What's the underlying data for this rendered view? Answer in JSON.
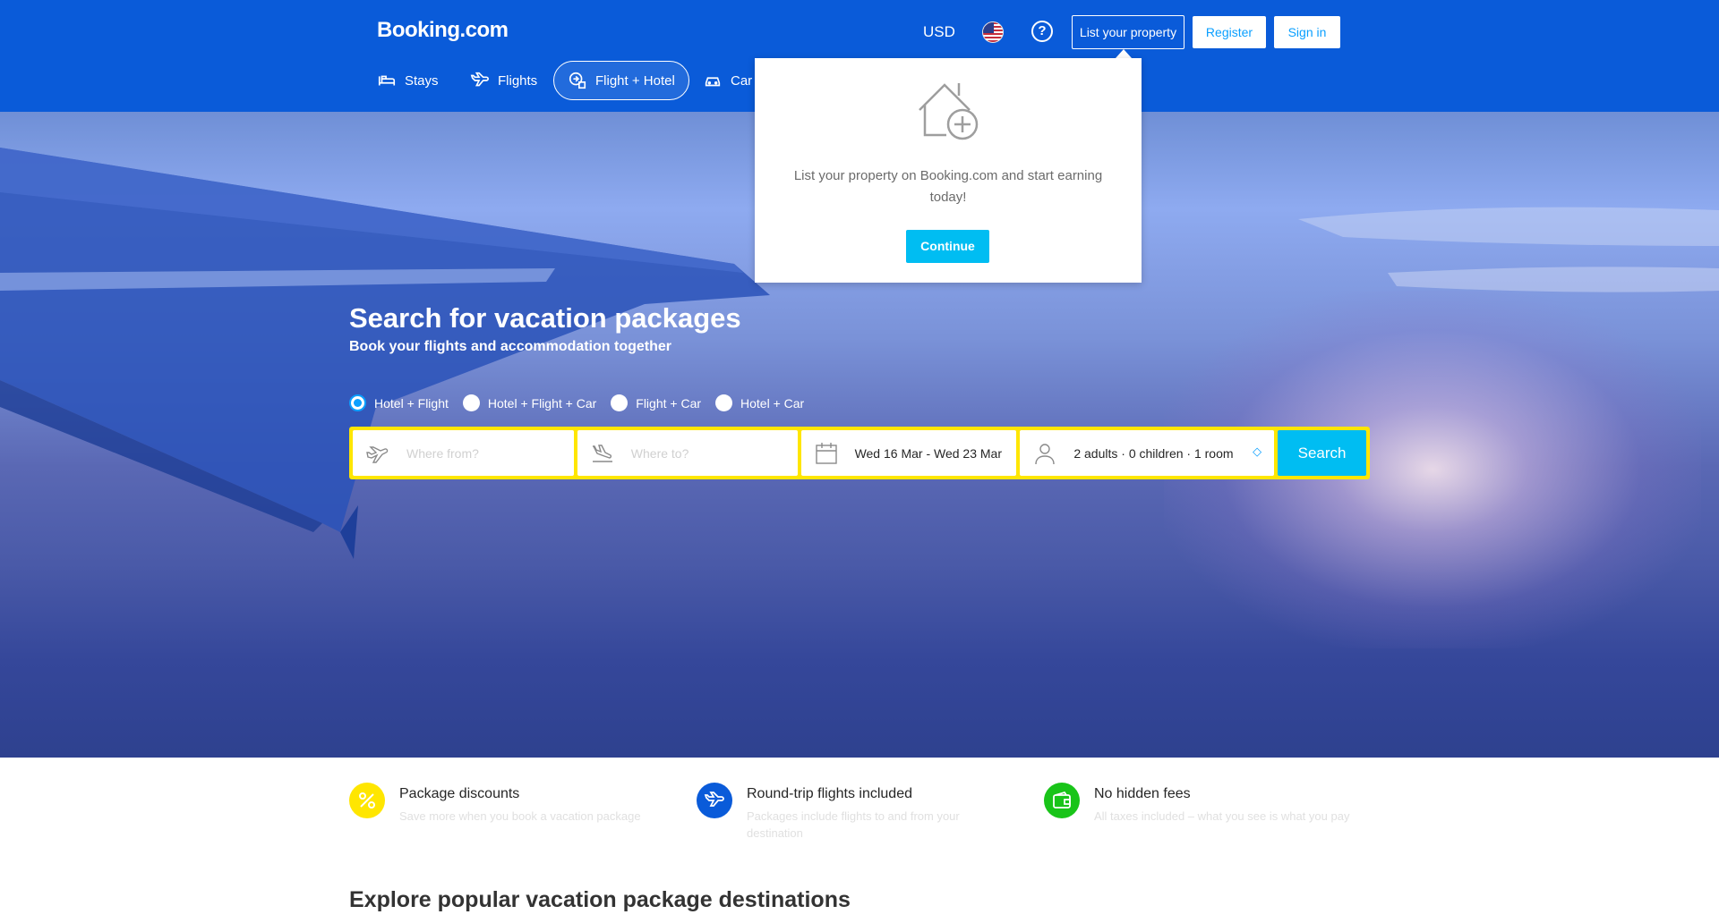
{
  "header": {
    "logo": "Booking.com",
    "currency": "USD",
    "help_symbol": "?",
    "list_property": "List your property",
    "register": "Register",
    "sign_in": "Sign in"
  },
  "nav": {
    "items": [
      {
        "label": "Stays",
        "icon": "bed-icon"
      },
      {
        "label": "Flights",
        "icon": "plane-icon"
      },
      {
        "label": "Flight + Hotel",
        "icon": "flight-hotel-icon",
        "active": true
      },
      {
        "label": "Car r",
        "icon": "car-icon"
      }
    ]
  },
  "popup": {
    "text": "List your property on Booking.com and start earning today!",
    "button": "Continue"
  },
  "hero": {
    "title": "Search for vacation packages",
    "subtitle": "Book your flights and accommodation together"
  },
  "package_types": [
    {
      "label": "Hotel + Flight",
      "checked": true
    },
    {
      "label": "Hotel + Flight + Car",
      "checked": false
    },
    {
      "label": "Flight + Car",
      "checked": false
    },
    {
      "label": "Hotel + Car",
      "checked": false
    }
  ],
  "search": {
    "from_placeholder": "Where from?",
    "to_placeholder": "Where to?",
    "dates": "Wed 16 Mar - Wed 23 Mar",
    "guests": "2 adults · 0 children · 1 room",
    "button": "Search"
  },
  "features": [
    {
      "title": "Package discounts",
      "desc": "Save more when you book a vacation package",
      "color": "#ffe600",
      "icon": "percent-icon"
    },
    {
      "title": "Round-trip flights included",
      "desc": "Packages include flights to and from your destination",
      "color": "#0a5bd9",
      "icon": "plane-icon"
    },
    {
      "title": "No hidden fees",
      "desc": "All taxes included – what you see is what you pay",
      "color": "#19c419",
      "icon": "wallet-icon"
    }
  ],
  "explore_title": "Explore popular vacation package destinations",
  "colors": {
    "brand_blue": "#0a5bd9",
    "accent": "#00bdf2",
    "highlight": "#ffe600"
  }
}
